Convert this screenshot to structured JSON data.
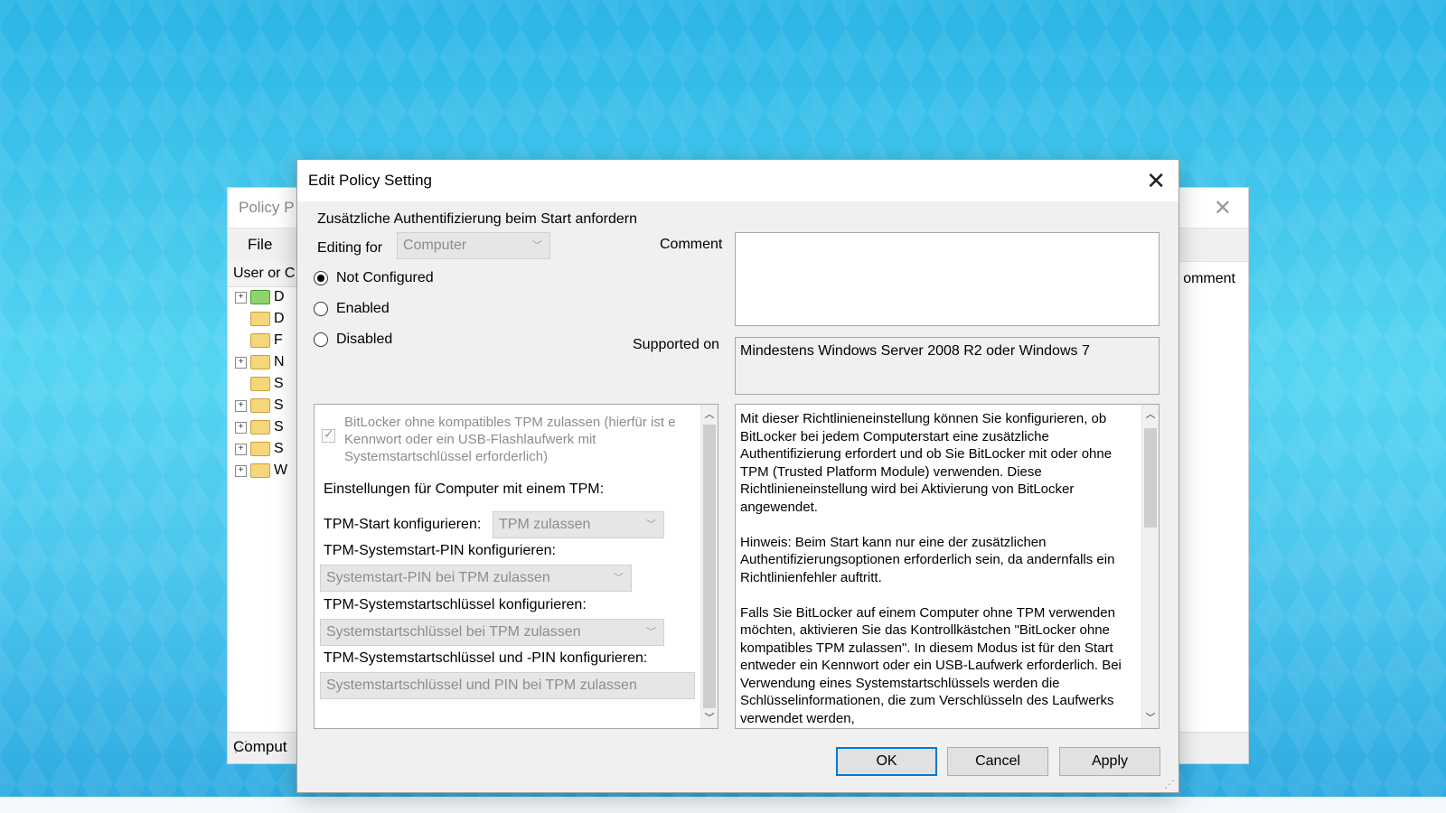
{
  "background_window": {
    "title": "Policy P",
    "menu_file": "File",
    "tree_header": "User or C",
    "column_comment": "omment",
    "tree_items": [
      "D",
      "D",
      "F",
      "N",
      "S",
      "S",
      "S",
      "S",
      "W"
    ],
    "status_text": "Comput"
  },
  "dialog": {
    "title": "Edit Policy Setting",
    "policy_name": "Zusätzliche Authentifizierung beim Start anfordern",
    "editing_for_label": "Editing for",
    "editing_for_value": "Computer",
    "comment_label": "Comment",
    "comment_value": "",
    "supported_on_label": "Supported on",
    "supported_on_value": "Mindestens Windows Server 2008 R2 oder Windows 7",
    "radios": {
      "not_configured": "Not Configured",
      "enabled": "Enabled",
      "disabled": "Disabled",
      "selected": "not_configured"
    },
    "options": {
      "bitlocker_checkbox_label": "BitLocker ohne kompatibles TPM zulassen (hierfür ist e Kennwort oder ein USB-Flashlaufwerk mit Systemstartschlüssel erforderlich)",
      "bitlocker_checked": true,
      "tpm_section_heading": "Einstellungen für Computer mit einem TPM:",
      "tpm_start_label": "TPM-Start konfigurieren:",
      "tpm_start_value": "TPM zulassen",
      "tpm_pin_label": "TPM-Systemstart-PIN konfigurieren:",
      "tpm_pin_value": "Systemstart-PIN bei TPM zulassen",
      "tpm_key_label": "TPM-Systemstartschlüssel konfigurieren:",
      "tpm_key_value": "Systemstartschlüssel bei TPM zulassen",
      "tpm_key_pin_label": "TPM-Systemstartschlüssel und -PIN konfigurieren:",
      "tpm_key_pin_value": "Systemstartschlüssel und PIN bei TPM zulassen"
    },
    "help_text": "Mit dieser Richtlinieneinstellung können Sie konfigurieren, ob BitLocker bei jedem Computerstart eine zusätzliche Authentifizierung erfordert und ob Sie BitLocker mit oder ohne TPM (Trusted Platform Module) verwenden. Diese Richtlinieneinstellung wird bei Aktivierung von BitLocker angewendet.\n\nHinweis: Beim Start kann nur eine der zusätzlichen Authentifizierungsoptionen erforderlich sein, da andernfalls ein Richtlinienfehler auftritt.\n\nFalls Sie BitLocker auf einem Computer ohne TPM verwenden möchten, aktivieren Sie das Kontrollkästchen \"BitLocker ohne kompatibles TPM zulassen\". In diesem Modus ist für den Start entweder ein Kennwort oder ein USB-Laufwerk erforderlich. Bei Verwendung eines Systemstartschlüssels werden die Schlüsselinformationen, die zum Verschlüsseln des Laufwerks verwendet werden,",
    "buttons": {
      "ok": "OK",
      "cancel": "Cancel",
      "apply": "Apply"
    }
  },
  "icons": {
    "close": "close-icon",
    "dropdown": "chevron-down-icon",
    "scroll_up": "chevron-up-icon",
    "scroll_down": "chevron-down-icon",
    "folder": "folder-icon",
    "expand": "plus-icon"
  },
  "colors": {
    "accent": "#0078d7",
    "dialog_bg": "#f0f0f0",
    "disabled_text": "#8d8d8d"
  }
}
